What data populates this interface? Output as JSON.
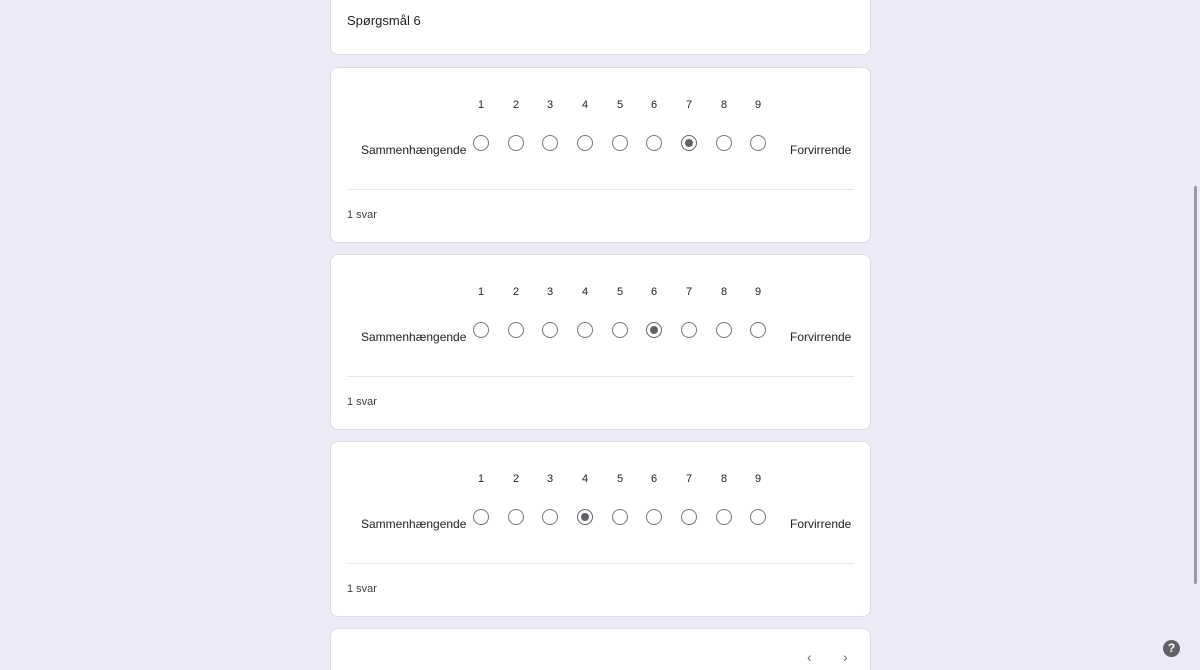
{
  "question": {
    "title": "Spørgsmål 6"
  },
  "scale_labels": {
    "low": "Sammenhængende",
    "high": "Forvirrende"
  },
  "scale_values": [
    "1",
    "2",
    "3",
    "4",
    "5",
    "6",
    "7",
    "8",
    "9"
  ],
  "summaries": [
    {
      "selected": 7,
      "count_label": "1 svar"
    },
    {
      "selected": 6,
      "count_label": "1 svar"
    },
    {
      "selected": 4,
      "count_label": "1 svar"
    }
  ],
  "navigation": {
    "prev_label": "‹",
    "next_label": "›"
  },
  "help": {
    "label": "?"
  },
  "colors": {
    "background": "#ede9f6",
    "card": "#ffffff",
    "radio": "#757575",
    "accent": "#7b74a6"
  },
  "icons": {
    "help": "help-circle-icon",
    "prev": "chevron-left-icon",
    "next": "chevron-right-icon"
  }
}
